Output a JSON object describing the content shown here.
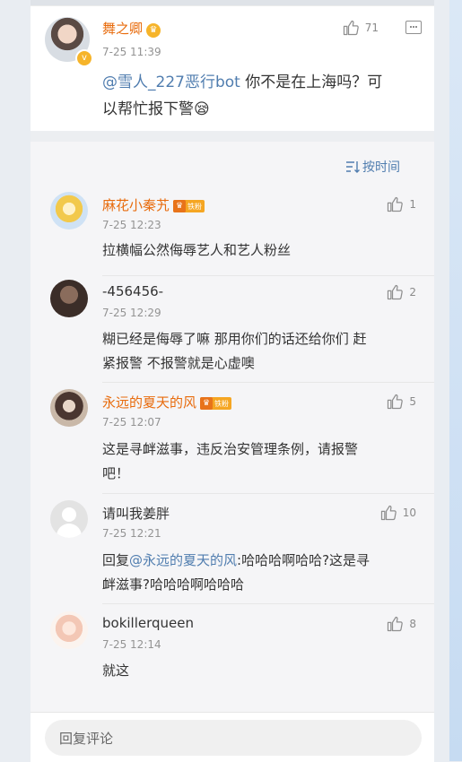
{
  "post": {
    "user": "舞之卿",
    "time": "7-25 11:39",
    "likes": "71",
    "mention": "@雪人_227恶行bot",
    "text_line1": " 你不是在上海吗？可",
    "text_line2": "以帮忙报下警",
    "emoji": "😪"
  },
  "sort": {
    "label": "按时间"
  },
  "badge_text": "铁粉",
  "replies": [
    {
      "user": "麻花小秦艽",
      "time": "7-25 12:23",
      "likes": "1",
      "lines": [
        "拉横幅公然侮辱艺人和艺人粉丝"
      ]
    },
    {
      "user": "-456456-",
      "time": "7-25 12:29",
      "likes": "2",
      "lines": [
        "糊已经是侮辱了嘛 那用你们的话还给你们 赶",
        "紧报警 不报警就是心虚噢"
      ]
    },
    {
      "user": "永远的夏天的风",
      "time": "7-25 12:07",
      "likes": "5",
      "lines": [
        "这是寻衅滋事，违反治安管理条例，请报警",
        "吧！"
      ]
    },
    {
      "user": "请叫我姜胖",
      "time": "7-25 12:21",
      "likes": "10",
      "prefix": "回复",
      "mention": "@永远的夏天的风",
      "line1_rest": ":哈哈哈啊哈哈?这是寻",
      "line2": "衅滋事?哈哈哈啊哈哈哈"
    },
    {
      "user": "bokillerqueen",
      "time": "7-25 12:14",
      "likes": "8",
      "lines": [
        "就这"
      ]
    }
  ],
  "footer": {
    "placeholder": "回复评论"
  },
  "colors": {
    "username_fan": "#e86b0c",
    "link": "#507daf",
    "badge": "#f5a623"
  },
  "icons": [
    "thumbs-up-icon",
    "comment-icon",
    "sort-icon",
    "verified-icon",
    "crown-icon"
  ]
}
